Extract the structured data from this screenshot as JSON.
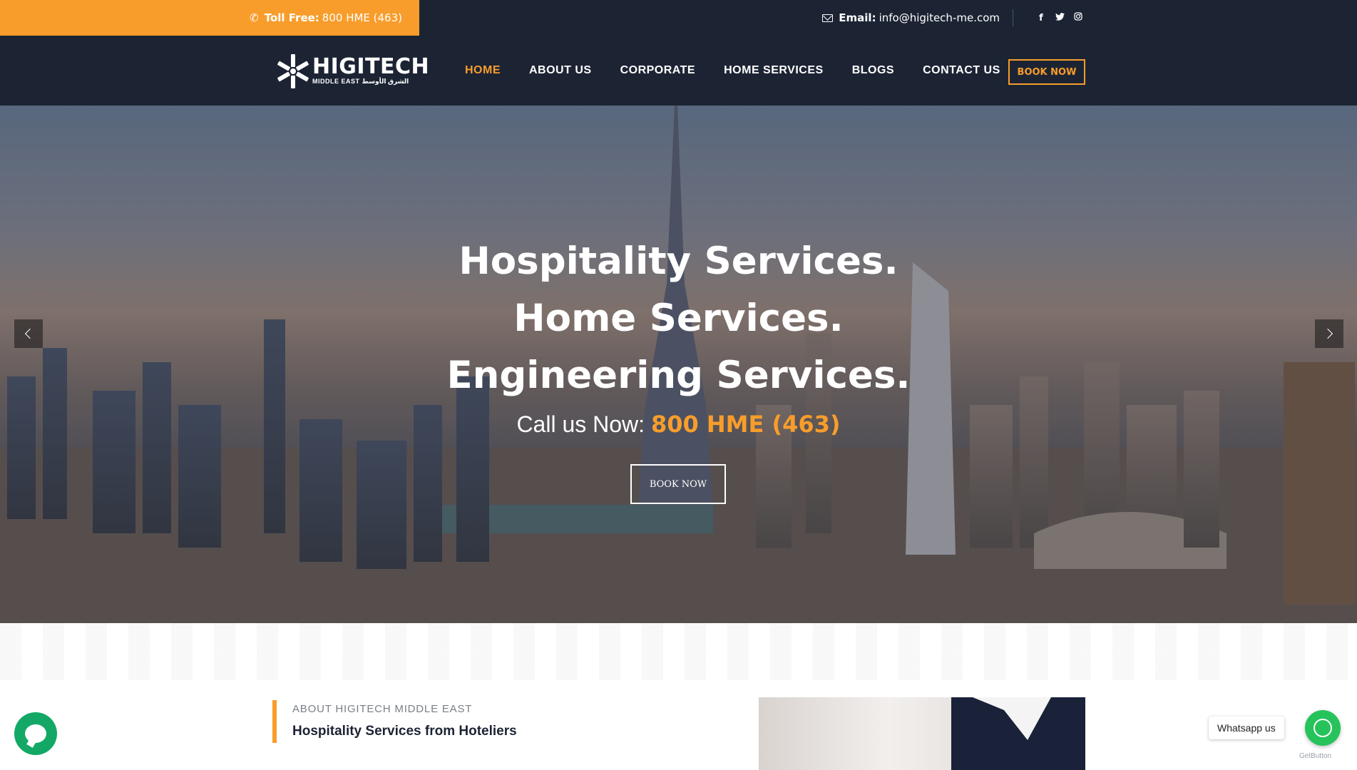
{
  "topbar": {
    "toll_free_label": "Toll Free:",
    "toll_free_number": "800 HME (463)",
    "email_label": "Email:",
    "email_value": "info@higitech-me.com",
    "social": [
      "facebook-icon",
      "twitter-icon",
      "instagram-icon"
    ]
  },
  "nav": {
    "logo_name": "HIGITECH",
    "logo_sub": "MIDDLE EAST الشرق الأوسط",
    "items": [
      "HOME",
      "ABOUT US",
      "CORPORATE",
      "HOME SERVICES",
      "BLOGS",
      "CONTACT US"
    ],
    "active": "HOME",
    "book_label": "BOOK NOW"
  },
  "hero": {
    "line1": "Hospitality Services.",
    "line2": "Home Services.",
    "line3": "Engineering Services.",
    "call_label": "Call us Now:",
    "call_number": "800 HME (463)",
    "book_label": "BOOK NOW"
  },
  "about": {
    "eyebrow": "ABOUT HIGITECH MIDDLE EAST",
    "title": "Hospitality Services from Hoteliers"
  },
  "widgets": {
    "whatsapp_label": "Whatsapp us",
    "getbutton": "GetButton"
  },
  "colors": {
    "accent": "#f89d2b",
    "dark": "#1c2434",
    "whatsapp": "#25c35a"
  }
}
